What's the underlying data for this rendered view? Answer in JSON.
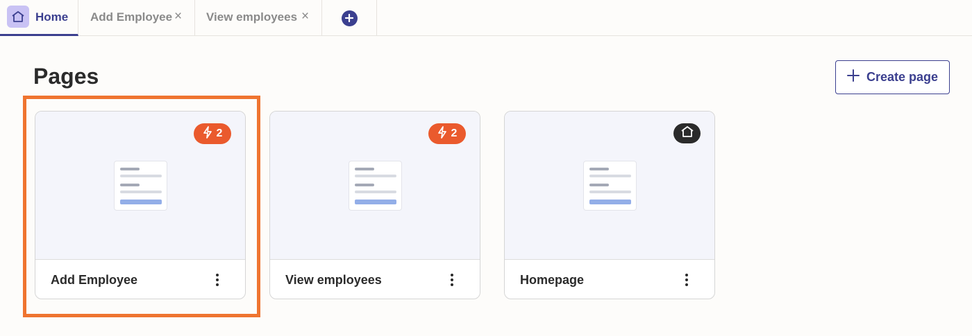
{
  "tabs": [
    {
      "label": "Home",
      "icon": "home-icon",
      "active": true
    },
    {
      "label": "Add Employee",
      "close_symbol": "×"
    },
    {
      "label": "View employees",
      "close_symbol": "×"
    }
  ],
  "header": {
    "title": "Pages",
    "create_label": "Create page"
  },
  "pages": [
    {
      "name": "Add Employee",
      "badge_icon": "lightning-icon",
      "badge_count": "2",
      "highlighted": true
    },
    {
      "name": "View employees",
      "badge_icon": "lightning-icon",
      "badge_count": "2"
    },
    {
      "name": "Homepage",
      "badge_icon": "home-icon"
    }
  ],
  "colors": {
    "accent": "#3b3f8f",
    "badge_orange": "#ea5a2d",
    "highlight_orange": "#ef7430",
    "home_tile": "#c9c2f4"
  }
}
